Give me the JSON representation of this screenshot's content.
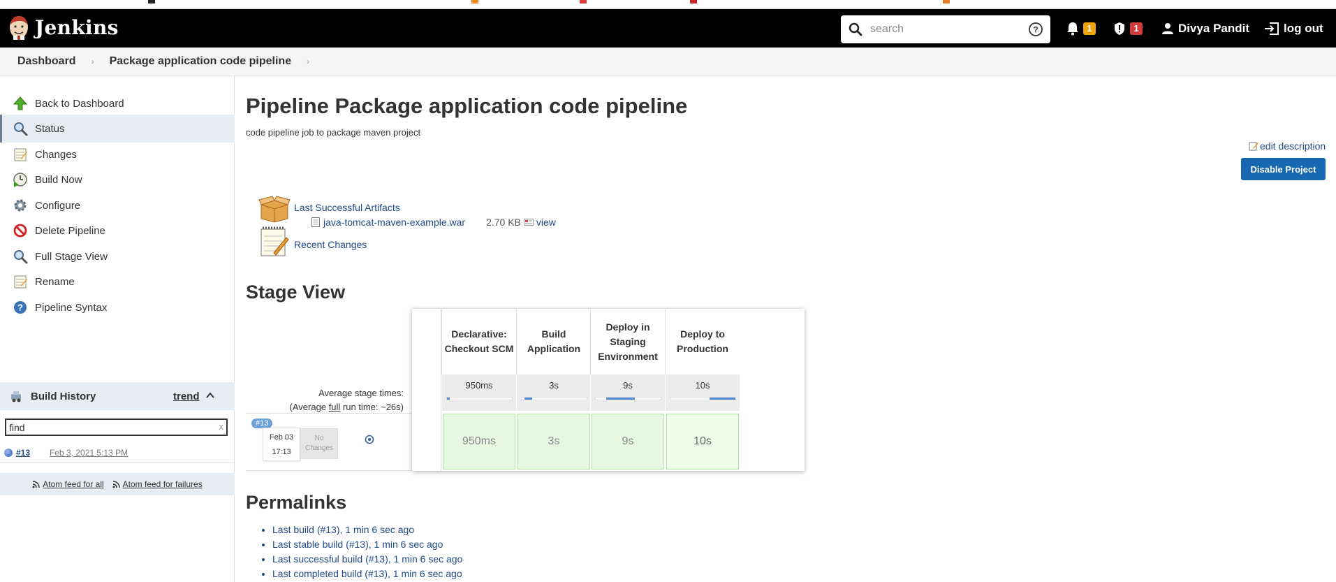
{
  "colors": {
    "header_bg": "#000000",
    "link": "#204a87",
    "primary_button": "#1768b0",
    "success_cell": "#e5f8e0",
    "notification_badge": "#f0a30a",
    "security_badge": "#d23c3c",
    "progress": "#5188d1"
  },
  "header": {
    "brand": "Jenkins",
    "search_placeholder": "search",
    "notifications_count": "1",
    "security_count": "1",
    "user_name": "Divya Pandit",
    "logout_label": "log out",
    "icons": [
      "jenkins-logo-icon",
      "search-icon",
      "help-icon",
      "bell-icon",
      "shield-icon",
      "user-icon",
      "logout-icon"
    ]
  },
  "breadcrumbs": [
    "Dashboard",
    "Package application code pipeline"
  ],
  "sidebar": {
    "tasks": [
      {
        "label": "Back to Dashboard",
        "icon": "up-arrow-icon"
      },
      {
        "label": "Status",
        "icon": "search-icon",
        "active": true
      },
      {
        "label": "Changes",
        "icon": "notepad-icon"
      },
      {
        "label": "Build Now",
        "icon": "clock-play-icon"
      },
      {
        "label": "Configure",
        "icon": "gear-icon"
      },
      {
        "label": "Delete Pipeline",
        "icon": "no-entry-icon"
      },
      {
        "label": "Full Stage View",
        "icon": "search-icon"
      },
      {
        "label": "Rename",
        "icon": "notepad-icon"
      },
      {
        "label": "Pipeline Syntax",
        "icon": "help-icon"
      }
    ],
    "build_history": {
      "title": "Build History",
      "trend_label": "trend",
      "filter_placeholder": "find",
      "filter_clear": "x",
      "builds": [
        {
          "number": "#13",
          "date": "Feb 3, 2021 5:13 PM"
        }
      ],
      "feed_all": "Atom feed for all",
      "feed_failures": "Atom feed for failures"
    }
  },
  "main": {
    "title": "Pipeline Package application code pipeline",
    "description": "code pipeline job to package maven project",
    "edit_description": "edit description",
    "disable_button": "Disable Project",
    "artifacts": {
      "title": "Last Successful Artifacts",
      "file_name": "java-tomcat-maven-example.war",
      "file_size": "2.70 KB",
      "view_label": "view"
    },
    "recent_changes": "Recent Changes",
    "stage_view": {
      "title": "Stage View",
      "avg_stage_label": "Average stage times:",
      "avg_run_prefix": "(Average ",
      "avg_run_link": "full",
      "avg_run_suffix": " run time: ~26s)",
      "stages": [
        {
          "name_line1": "Declarative:",
          "name_line2": "Checkout SCM",
          "name_line3": "",
          "avg": "950ms",
          "progress_start": 0.0,
          "progress_end": 0.04,
          "run_time": "950ms"
        },
        {
          "name_line1": "Build",
          "name_line2": "Application",
          "name_line3": "",
          "avg": "3s",
          "progress_start": 0.04,
          "progress_end": 0.16,
          "run_time": "3s"
        },
        {
          "name_line1": "Deploy in",
          "name_line2": "Staging",
          "name_line3": "Environment",
          "avg": "9s",
          "progress_start": 0.16,
          "progress_end": 0.6,
          "run_time": "9s"
        },
        {
          "name_line1": "Deploy to",
          "name_line2": "Production",
          "name_line3": "",
          "avg": "10s",
          "progress_start": 0.6,
          "progress_end": 1.0,
          "run_time": "10s"
        }
      ],
      "build": {
        "tag": "#13",
        "month_day": "Feb 03",
        "time": "17:13",
        "changes_line1": "No",
        "changes_line2": "Changes"
      }
    },
    "permalinks": {
      "title": "Permalinks",
      "items": [
        "Last build (#13), 1 min 6 sec ago",
        "Last stable build (#13), 1 min 6 sec ago",
        "Last successful build (#13), 1 min 6 sec ago",
        "Last completed build (#13), 1 min 6 sec ago"
      ]
    }
  }
}
